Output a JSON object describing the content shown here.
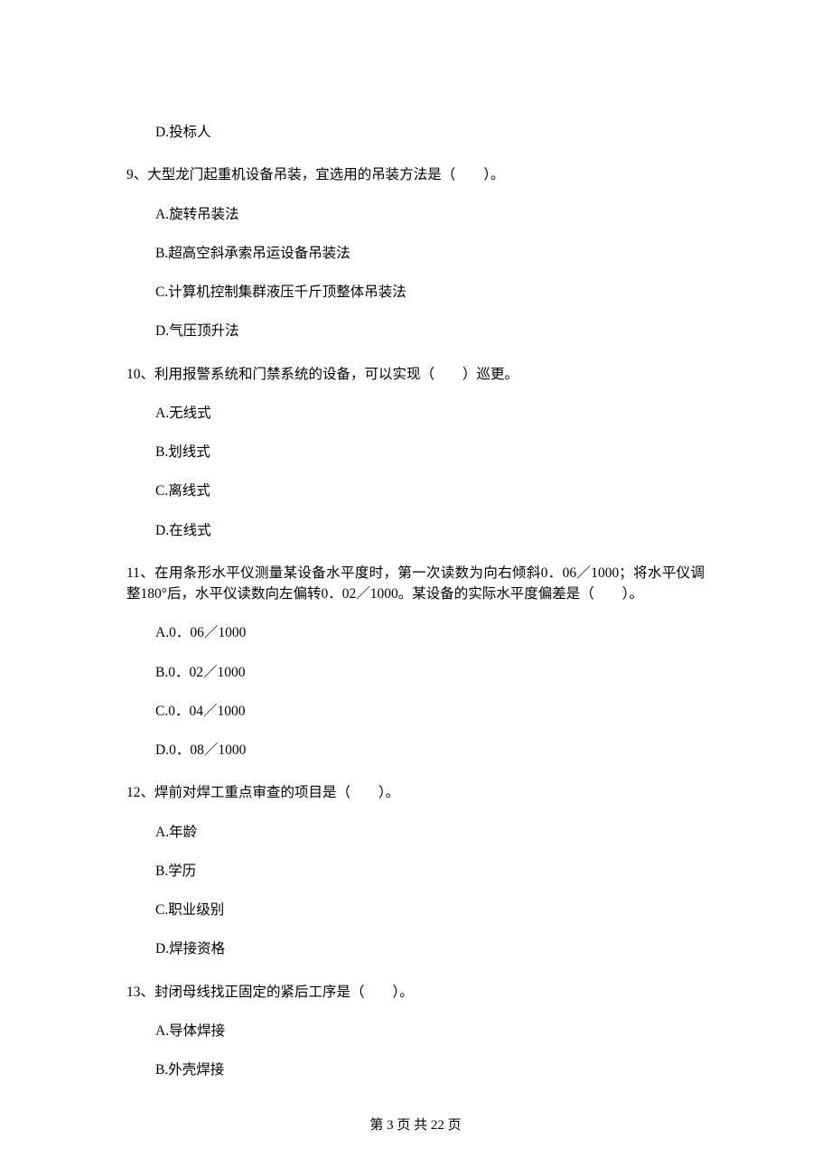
{
  "q8_optD": "D.投标人",
  "q9": "9、大型龙门起重机设备吊装，宜选用的吊装方法是（　　）。",
  "q9_A": "A.旋转吊装法",
  "q9_B": "B.超高空斜承索吊运设备吊装法",
  "q9_C": "C.计算机控制集群液压千斤顶整体吊装法",
  "q9_D": "D.气压顶升法",
  "q10": "10、利用报警系统和门禁系统的设备，可以实现（　　）巡更。",
  "q10_A": "A.无线式",
  "q10_B": "B.划线式",
  "q10_C": "C.离线式",
  "q10_D": "D.在线式",
  "q11": "11、在用条形水平仪测量某设备水平度时，第一次读数为向右倾斜0．06／1000；将水平仪调整180°后，水平仪读数向左偏转0．02／1000。某设备的实际水平度偏差是（　　）。",
  "q11_A": "A.0．06／1000",
  "q11_B": "B.0．02／1000",
  "q11_C": "C.0．04／1000",
  "q11_D": "D.0．08／1000",
  "q12": "12、焊前对焊工重点审查的项目是（　　）。",
  "q12_A": "A.年龄",
  "q12_B": "B.学历",
  "q12_C": "C.职业级别",
  "q12_D": "D.焊接资格",
  "q13": "13、封闭母线找正固定的紧后工序是（　　）。",
  "q13_A": "A.导体焊接",
  "q13_B": "B.外壳焊接",
  "footer": "第 3 页 共 22 页"
}
